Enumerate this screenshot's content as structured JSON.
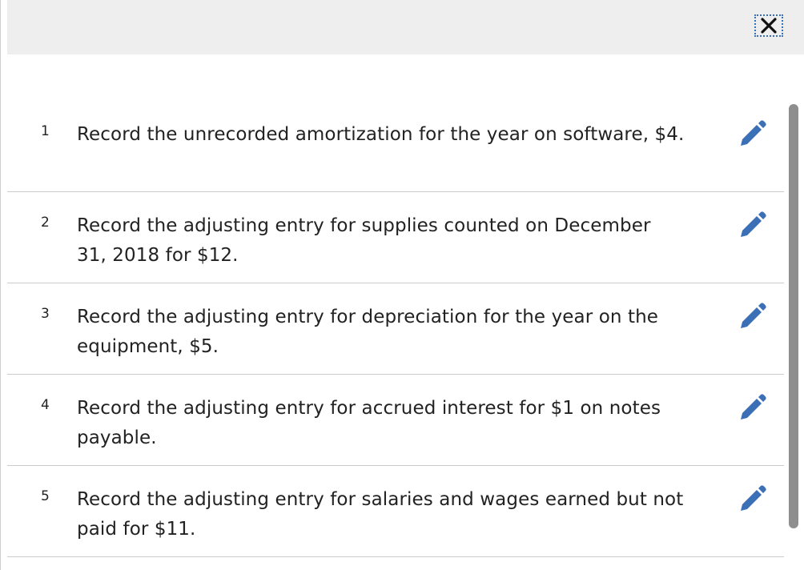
{
  "dialog": {
    "close_icon": "close-x-icon",
    "items": [
      {
        "number": "1",
        "text": "Record the unrecorded amortization for the year on software, $4.",
        "edit_icon": "pencil-icon"
      },
      {
        "number": "2",
        "text": "Record the adjusting entry for supplies counted on December 31, 2018 for $12.",
        "edit_icon": "pencil-icon"
      },
      {
        "number": "3",
        "text": "Record the adjusting entry for depreciation for the year on the equipment, $5.",
        "edit_icon": "pencil-icon"
      },
      {
        "number": "4",
        "text": "Record the adjusting entry for accrued interest for $1 on notes payable.",
        "edit_icon": "pencil-icon"
      },
      {
        "number": "5",
        "text": "Record the adjusting entry for salaries and wages earned but not paid for $11.",
        "edit_icon": "pencil-icon"
      }
    ]
  },
  "colors": {
    "accent": "#3b6fb6",
    "titlebar_bg": "#eeeeee",
    "divider": "#cccccc",
    "scrollbar": "#8e8e8e"
  }
}
